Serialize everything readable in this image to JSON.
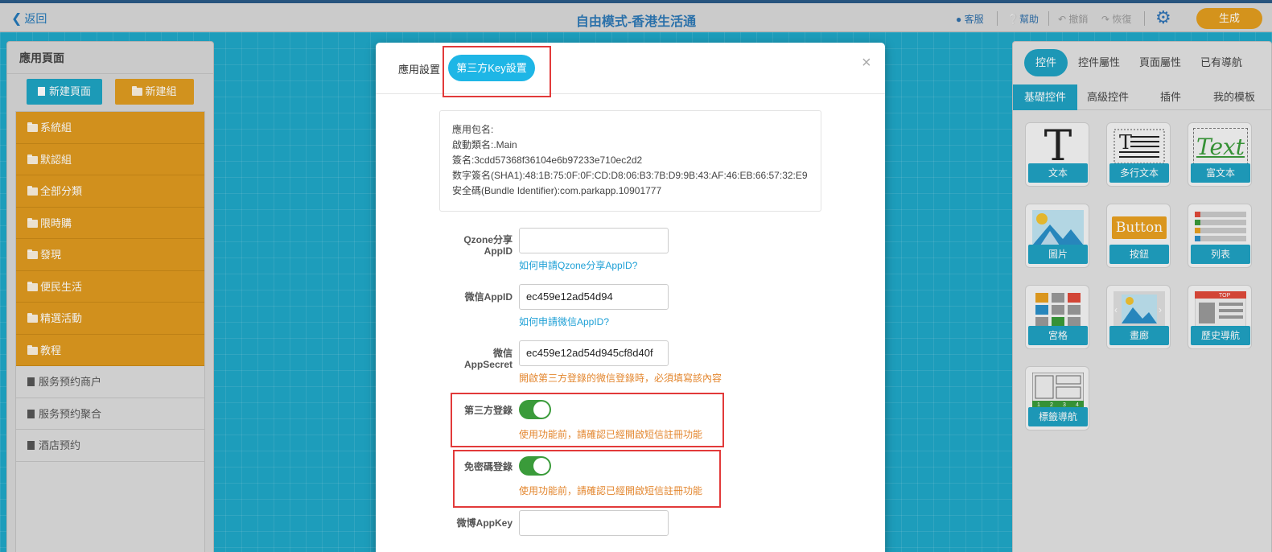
{
  "header": {
    "back_label": "返回",
    "title": "自由模式-香港生活通",
    "service_label": "客服",
    "help_label": "幫助",
    "undo_label": "撤銷",
    "redo_label": "恢復",
    "generate_label": "生成"
  },
  "left_panel": {
    "title": "應用頁面",
    "new_page_label": "新建頁面",
    "new_group_label": "新建組",
    "groups": [
      "系統組",
      "默認組",
      "全部分類",
      "限時購",
      "發現",
      "便民生活",
      "精選活動",
      "教程"
    ],
    "pages": [
      "服务预约商户",
      "服务预约聚合",
      "酒店预约"
    ]
  },
  "right_panel": {
    "tabs": [
      "控件",
      "控件屬性",
      "頁面屬性",
      "已有導航"
    ],
    "subtabs": [
      "基礎控件",
      "高級控件",
      "插件",
      "我的模板"
    ],
    "widgets": [
      "文本",
      "多行文本",
      "富文本",
      "圖片",
      "按鈕",
      "列表",
      "宮格",
      "畫廊",
      "歷史導航",
      "標籤導航"
    ],
    "icon_text": {
      "text_glyph": "T",
      "rich_text": "Text",
      "button": "Button",
      "top": "TOP",
      "tab_nums": [
        "1",
        "2",
        "3",
        "4"
      ]
    },
    "accent_color": "#1fa1c2"
  },
  "modal": {
    "tab_app_settings": "應用設置",
    "tab_third_party": "第三方Key設置",
    "close_label": "×",
    "info_lines": [
      "應用包名:",
      "啟動類名:.Main",
      "簽名:3cdd57368f36104e6b97233e710ec2d2",
      "数字簽名(SHA1):48:1B:75:0F:0F:CD:D8:06:B3:7B:D9:9B:43:AF:46:EB:66:57:32:E9",
      "安全碼(Bundle Identifier):com.parkapp.10901777"
    ],
    "qzone_label": "Qzone分享AppID",
    "qzone_value": "",
    "qzone_link": "如何申請Qzone分享AppID?",
    "wechat_appid_label": "微信AppID",
    "wechat_appid_value": "ec459e12ad54d94",
    "wechat_appid_link": "如何申請微信AppID?",
    "wechat_secret_label": "微信AppSecret",
    "wechat_secret_value": "ec459e12ad54d945cf8d40f",
    "wechat_secret_hint": "開啟第三方登錄的微信登錄時，必須填寫該內容",
    "third_party_login_label": "第三方登錄",
    "third_party_login_on": true,
    "third_party_login_hint": "使用功能前，請確認已經開啟短信註冊功能",
    "passwordless_login_label": "免密碼登錄",
    "passwordless_login_on": true,
    "passwordless_login_hint": "使用功能前，請確認已經開啟短信註冊功能",
    "weibo_label": "微博AppKey",
    "weibo_value": ""
  }
}
